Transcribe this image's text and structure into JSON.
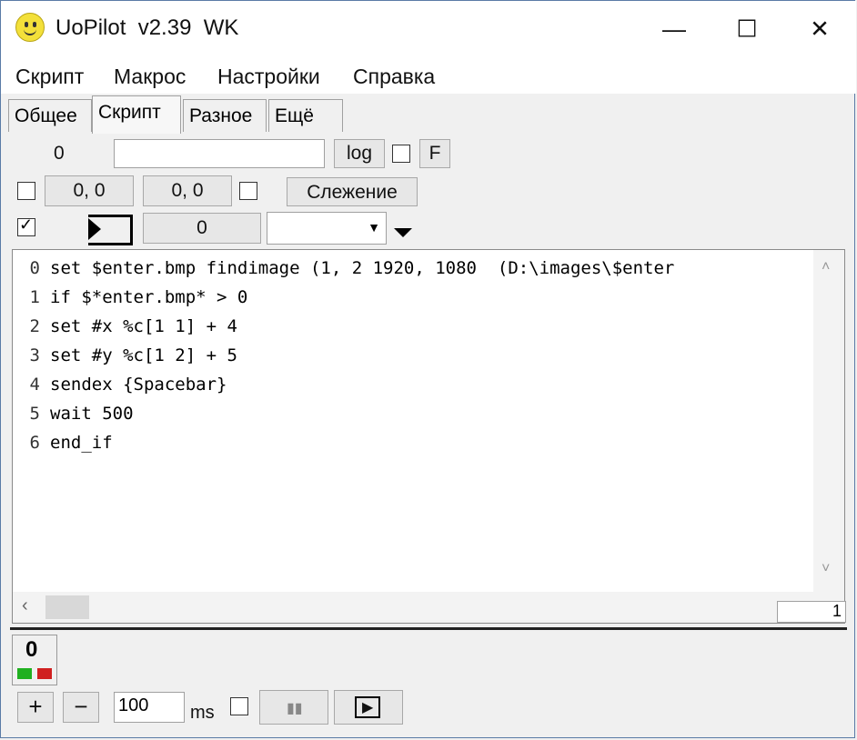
{
  "window": {
    "title": "UoPilot  v2.39  WK"
  },
  "menu": [
    "Скрипт",
    "Макрос",
    "Настройки",
    "Справка"
  ],
  "tabs": [
    "Общее",
    "Скрипт",
    "Разное",
    "Ещё"
  ],
  "row1": {
    "counter": "0",
    "input": "",
    "log": "log",
    "f": "F"
  },
  "row2": {
    "coord1": "0, 0",
    "coord2": "0, 0",
    "tracking": "Слежение"
  },
  "row3": {
    "value": "0",
    "select": ""
  },
  "editor": {
    "lines": [
      "0",
      "1",
      "2",
      "3",
      "4",
      "5",
      "6"
    ],
    "code": [
      "set $enter.bmp findimage (1, 2 1920, 1080  (D:\\images\\$enter",
      "if $*enter.bmp* > 0",
      "set #x %c[1 1] + 4",
      "set #y %c[1 2] + 5",
      "sendex {Spacebar}",
      "wait 500",
      "end_if"
    ],
    "line_indicator": "1"
  },
  "status": {
    "count": "0"
  },
  "bottom": {
    "plus": "+",
    "minus": "−",
    "ms_value": "100",
    "ms": "ms"
  }
}
